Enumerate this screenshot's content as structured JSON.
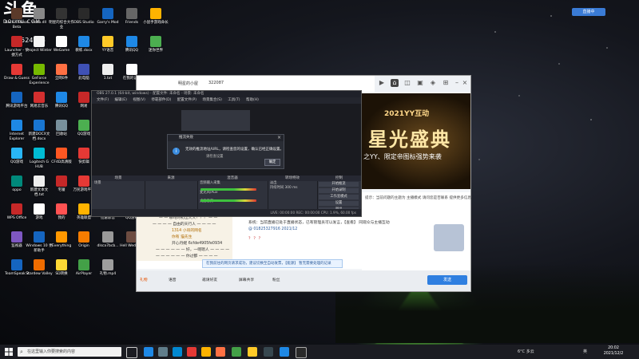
{
  "logo": {
    "mark": "斗鱼",
    "sub": "DOUYU.COM",
    "room_id": "14524306"
  },
  "top_badge": "直播中",
  "desktop_icons": [
    {
      "label": "Back 4 Blood Beta",
      "color": "#5b3a2a"
    },
    {
      "label": "nodo.dll",
      "color": "#888"
    },
    {
      "label": "明星的综合大作业",
      "color": "#333"
    },
    {
      "label": "OBS Studio",
      "color": "#2a2a2a"
    },
    {
      "label": "Garry's Mod",
      "color": "#1565c0"
    },
    {
      "label": "Friends",
      "color": "#666"
    },
    {
      "label": "小鼠手游戏命长",
      "color": "#ffb300"
    },
    {
      "label": "Launcher - 快捷方式",
      "color": "#c62828"
    },
    {
      "label": "Project Winter",
      "color": "#f5f5f5"
    },
    {
      "label": "WeGame",
      "color": "#fff"
    },
    {
      "label": "教练.docx",
      "color": "#1e88e5"
    },
    {
      "label": "YY语音",
      "color": "#ffca28"
    },
    {
      "label": "腾讯QQ",
      "color": "#1e88e5"
    },
    {
      "label": "迷你世界",
      "color": "#4caf50"
    },
    {
      "label": "Draw & Guess",
      "color": "#e53935"
    },
    {
      "label": "GeForce Experience",
      "color": "#76b900"
    },
    {
      "label": "全网0件",
      "color": "#ff7043"
    },
    {
      "label": "此电脑",
      "color": "#3f51b5"
    },
    {
      "label": "1.txt",
      "color": "#eee"
    },
    {
      "label": "在我的记中",
      "color": "#fff"
    },
    {
      "label": "腾讯游戏平台",
      "color": "#1565c0"
    },
    {
      "label": "网易云音乐",
      "color": "#d32f2f"
    },
    {
      "label": "腾讯QQ",
      "color": "#1e88e5"
    },
    {
      "label": "网易",
      "color": "#c62828"
    },
    {
      "label": "PICO PARK",
      "color": "#ff8f00"
    },
    {
      "label": "微软Edge",
      "color": "#0097a7"
    },
    {
      "label": "Internet Explorer",
      "color": "#1e88e5"
    },
    {
      "label": "新建DOCX文档.docx",
      "color": "#1976d2"
    },
    {
      "label": "回收站",
      "color": "#78909c"
    },
    {
      "label": "QQ游戏",
      "color": "#4caf50"
    },
    {
      "label": "spngifeTS...",
      "color": "#ef6c00"
    },
    {
      "label": "Microsoft Store",
      "color": "#0288d1"
    },
    {
      "label": "QQ游戏",
      "color": "#29b6f6"
    },
    {
      "label": "Logitech G HUB",
      "color": "#00bcd4"
    },
    {
      "label": "CF4D高清版",
      "color": "#ff5722"
    },
    {
      "label": "快剪辑",
      "color": "#e53935"
    },
    {
      "label": "音乐",
      "color": "#ffd54f"
    },
    {
      "label": "DEVOUR",
      "color": "#b71c1c"
    },
    {
      "label": "oppo",
      "color": "#00897b"
    },
    {
      "label": "新建文本文档.txt",
      "color": "#eee"
    },
    {
      "label": "宅寝",
      "color": "#c62828"
    },
    {
      "label": "万民游戏平台",
      "color": "#e53935"
    },
    {
      "label": "Fling to the Finish",
      "color": "#43a047"
    },
    {
      "label": "QQ游戏",
      "color": "#1e88e5"
    },
    {
      "label": "WPS Office",
      "color": "#c62828"
    },
    {
      "label": "游戏",
      "color": "#fff"
    },
    {
      "label": "我的",
      "color": "#ff5252"
    },
    {
      "label": "英雄联盟",
      "color": "#ffb300"
    },
    {
      "label": "迅雷影音",
      "color": "#1e88e5"
    },
    {
      "label": "QQ游戏",
      "color": "#ffeb3b"
    },
    {
      "label": "监视器",
      "color": "#7e57c2"
    },
    {
      "label": "Windows 10 更新助手",
      "color": "#1565c0"
    },
    {
      "label": "Everything",
      "color": "#ff9800"
    },
    {
      "label": "Origin",
      "color": "#f57c00"
    },
    {
      "label": "dlsca7bcb...",
      "color": "#999"
    },
    {
      "label": "Hell Wedding",
      "color": "#6d4c41"
    },
    {
      "label": "TeamSpeak 3",
      "color": "#1565c0"
    },
    {
      "label": "Stardew Valley",
      "color": "#ef6c00"
    },
    {
      "label": "SD转换",
      "color": "#fdd835"
    },
    {
      "label": "AirPlayer",
      "color": "#43a047"
    },
    {
      "label": "礼物.mp4",
      "color": "#9e9e9e"
    }
  ],
  "yy": {
    "title": "明星的小屋",
    "viewer_count": "322087",
    "banner_top": "2021YY互动",
    "banner_main": "星光盛典",
    "banner_sub": "之YY、限定帝图标强势来袭",
    "chat": [
      "一 一 哪咤的初出大大！！！ 一 一",
      "一 一 一 一 自由的天行人 一 一 一 一",
      "1314 小哥的网名",
      "你有 猫先生",
      "开心丹妮 6cfde4905fe0934",
      "一 一 一 一 一 一 好，一呢嗯人 一 一 一 一",
      "一 一 一 一 一 一 你过都 一 一 一 一"
    ],
    "notice": "在我前往的网页请求成功，建议切换至自动发票，【能源】 暂无需要处理的记录",
    "right_lines": [
      "提示：当前问题的主题为 主播模式 请问您是否联系 提供更多信息",
      "系统：当前直播已处于直播状态，已有管理员可以发言，【查看】 同观众与主播互动",
      "@ 01825327916 2021/12",
      "？ ？ ？"
    ],
    "bottom": {
      "gift": "礼物",
      "mic": "语音",
      "invite": "邀请好友",
      "screen": "屏幕共享",
      "fans": "粉丝",
      "send": "发送"
    }
  },
  "obs": {
    "title": "OBS 27.0.1 (64-bit, windows) - 配置文件: 未命名 - 场景: 未命名",
    "menu": [
      "文件(F)",
      "编辑(E)",
      "视图(V)",
      "停靠部件(D)",
      "配置文件(P)",
      "场景集合(S)",
      "工具(T)",
      "帮助(H)"
    ],
    "docks": [
      "场景",
      "来源",
      "混音器",
      "转场特效",
      "控制"
    ],
    "scene": "场景",
    "mixer": [
      {
        "name": "音频输入采集",
        "db": "0.0 dB"
      },
      {
        "name": "麦克风/Aux",
        "db": "0.0 dB"
      },
      {
        "name": "桌面音频",
        "db": "-5.7 dB"
      }
    ],
    "transition": "淡出",
    "duration": "持续时间 300 ms",
    "controls": [
      "开始推流",
      "开始录制",
      "工作室模式",
      "设置",
      "退出"
    ],
    "status": "LIVE: 00:00:00   REC: 00:00:00   CPU: 1.9%, 60.00 fps"
  },
  "dialog": {
    "title": "推流失败",
    "message": "无效的推流地址/URL，请检查您的设置，确认已经正确设置。",
    "sub": "请检查设置",
    "ok": "确定"
  },
  "taskbar": {
    "search_placeholder": "在这里输入你要搜索的内容",
    "weather": "6°C 多云",
    "lang": "英",
    "time": "20:02",
    "date": "2021/12/2"
  }
}
